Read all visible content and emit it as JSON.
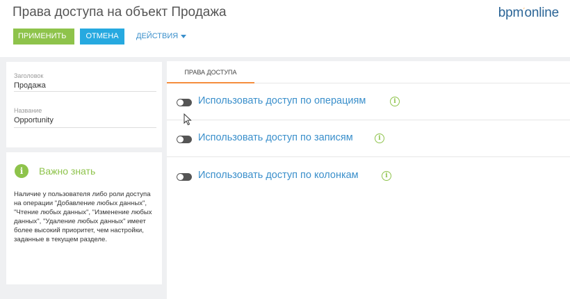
{
  "header": {
    "title": "Права доступа на объект Продажа",
    "logo": "bpm",
    "logo_suffix": "online",
    "logo_mark": "′",
    "apply_label": "ПРИМЕНИТЬ",
    "cancel_label": "ОТМЕНА",
    "actions_label": "ДЕЙСТВИЯ"
  },
  "fields": [
    {
      "caption": "Заголовок",
      "value": "Продажа"
    },
    {
      "caption": "Название",
      "value": "Opportunity"
    }
  ],
  "info": {
    "icon": "i",
    "title": "Важно знать",
    "text": "Наличие у пользователя либо роли доступа на операции \"Добавление любых данных\", \"Чтение любых данных\", \"Изменение любых данных\", \"Удаление любых данных\" имеет более высокий приоритет, чем настройки, заданные в текущем разделе."
  },
  "tabs": [
    {
      "label": "ПРАВА ДОСТУПА"
    }
  ],
  "access_rows": [
    {
      "label": "Использовать доступ по операциям",
      "enabled": false
    },
    {
      "label": "Использовать доступ по записям",
      "enabled": false
    },
    {
      "label": "Использовать доступ по колонкам",
      "enabled": false
    }
  ],
  "colors": {
    "accent_green": "#8ec34b",
    "accent_blue": "#26a9e0",
    "link_blue": "#3a8fcb",
    "tab_underline": "#f58d3c"
  }
}
